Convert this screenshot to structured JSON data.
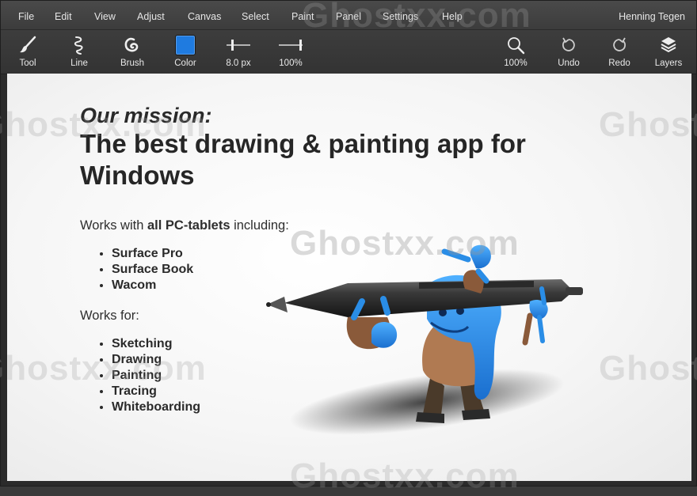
{
  "menubar": {
    "items": [
      "File",
      "Edit",
      "View",
      "Adjust",
      "Canvas",
      "Select",
      "Paint",
      "Panel",
      "Settings",
      "Help"
    ],
    "user": "Henning Tegen"
  },
  "toolbar": {
    "tool": {
      "label": "Tool",
      "icon": "brush-tool-icon"
    },
    "line": {
      "label": "Line",
      "icon": "line-icon"
    },
    "brush": {
      "label": "Brush",
      "icon": "brush-swirl-icon"
    },
    "color": {
      "label": "Color",
      "value": "#1f7be0"
    },
    "size": {
      "label": "8.0 px",
      "icon": "size-slider-icon"
    },
    "opacity": {
      "label": "100%",
      "icon": "opacity-slider-icon"
    },
    "zoom": {
      "label": "100%",
      "icon": "zoom-icon"
    },
    "undo": {
      "label": "Undo",
      "icon": "undo-icon"
    },
    "redo": {
      "label": "Redo",
      "icon": "redo-icon"
    },
    "layers": {
      "label": "Layers",
      "icon": "layers-icon"
    }
  },
  "page": {
    "kicker": "Our mission:",
    "headline": "The best drawing & painting app for Windows",
    "tablets_intro_pre": "Works with ",
    "tablets_intro_bold": "all PC-tablets",
    "tablets_intro_post": " including:",
    "tablets": [
      "Surface Pro",
      "Surface Book",
      "Wacom"
    ],
    "uses_intro": "Works for:",
    "uses": [
      "Sketching",
      "Drawing",
      "Painting",
      "Tracing",
      "Whiteboarding"
    ]
  },
  "watermark": "Ghostxx.com",
  "colors": {
    "pen_body": "#2e2e2e",
    "creature_blue": "#2a8de6",
    "accent": "#1f7be0"
  }
}
